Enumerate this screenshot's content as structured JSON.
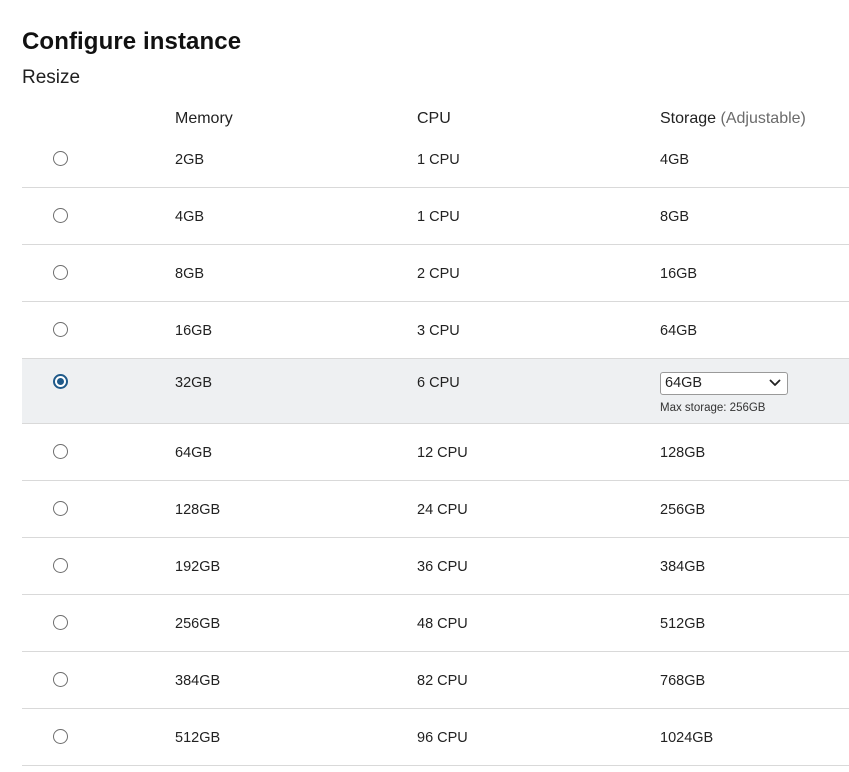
{
  "page": {
    "title": "Configure instance",
    "subtitle": "Resize"
  },
  "table": {
    "headers": {
      "memory": "Memory",
      "cpu": "CPU",
      "storage": "Storage",
      "storage_note": "(Adjustable)"
    },
    "rows": [
      {
        "memory": "2GB",
        "cpu": "1 CPU",
        "storage": "4GB",
        "selected": false
      },
      {
        "memory": "4GB",
        "cpu": "1 CPU",
        "storage": "8GB",
        "selected": false
      },
      {
        "memory": "8GB",
        "cpu": "2 CPU",
        "storage": "16GB",
        "selected": false
      },
      {
        "memory": "16GB",
        "cpu": "3 CPU",
        "storage": "64GB",
        "selected": false
      },
      {
        "memory": "32GB",
        "cpu": "6 CPU",
        "storage": "64GB",
        "selected": true,
        "max_storage": "Max storage: 256GB"
      },
      {
        "memory": "64GB",
        "cpu": "12 CPU",
        "storage": "128GB",
        "selected": false
      },
      {
        "memory": "128GB",
        "cpu": "24 CPU",
        "storage": "256GB",
        "selected": false
      },
      {
        "memory": "192GB",
        "cpu": "36 CPU",
        "storage": "384GB",
        "selected": false
      },
      {
        "memory": "256GB",
        "cpu": "48 CPU",
        "storage": "512GB",
        "selected": false
      },
      {
        "memory": "384GB",
        "cpu": "82 CPU",
        "storage": "768GB",
        "selected": false
      },
      {
        "memory": "512GB",
        "cpu": "96 CPU",
        "storage": "1024GB",
        "selected": false
      }
    ]
  },
  "colors": {
    "accent": "#1f5a8a",
    "selected_row_bg": "#eef0f2",
    "divider": "#d9d9d9"
  },
  "icons": {
    "dropdown": "chevron-down-icon"
  }
}
